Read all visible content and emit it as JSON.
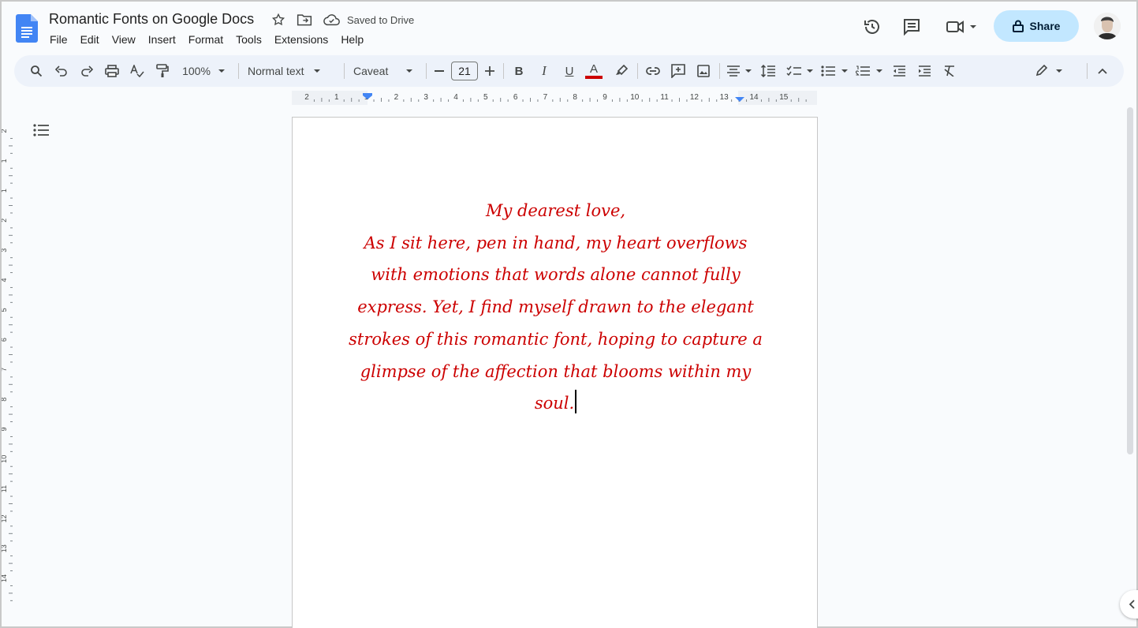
{
  "doc": {
    "title": "Romantic Fonts on Google Docs",
    "saved_status": "Saved to Drive"
  },
  "menu": [
    "File",
    "Edit",
    "View",
    "Insert",
    "Format",
    "Tools",
    "Extensions",
    "Help"
  ],
  "header": {
    "share_label": "Share"
  },
  "toolbar": {
    "zoom": "100%",
    "style": "Normal text",
    "font": "Caveat",
    "font_size": "21",
    "text_color": "#cc0000"
  },
  "ruler": {
    "h_marks": [
      "2",
      "1",
      "1",
      "2",
      "3",
      "4",
      "5",
      "6",
      "7",
      "8",
      "9",
      "10",
      "11",
      "12",
      "13",
      "14",
      "15"
    ],
    "v_marks": [
      "2",
      "1",
      "1",
      "2",
      "3",
      "4",
      "5",
      "6",
      "7",
      "8",
      "9",
      "10",
      "11",
      "12",
      "13",
      "14"
    ]
  },
  "document_text": {
    "lines": [
      "My dearest love,",
      "As I sit here, pen in hand, my heart overflows",
      "with emotions that words alone cannot fully",
      "express. Yet, I find myself drawn to the elegant",
      "strokes of this romantic font, hoping to capture a",
      "glimpse of the affection that blooms within my",
      "soul."
    ]
  },
  "icons": {
    "logo": "docs-logo-icon",
    "star": "star-icon",
    "move": "folder-move-icon",
    "cloud": "cloud-saved-icon",
    "history": "history-icon",
    "comments": "comments-icon",
    "meet": "video-call-icon",
    "lock": "lock-icon",
    "outline": "outline-list-icon"
  }
}
